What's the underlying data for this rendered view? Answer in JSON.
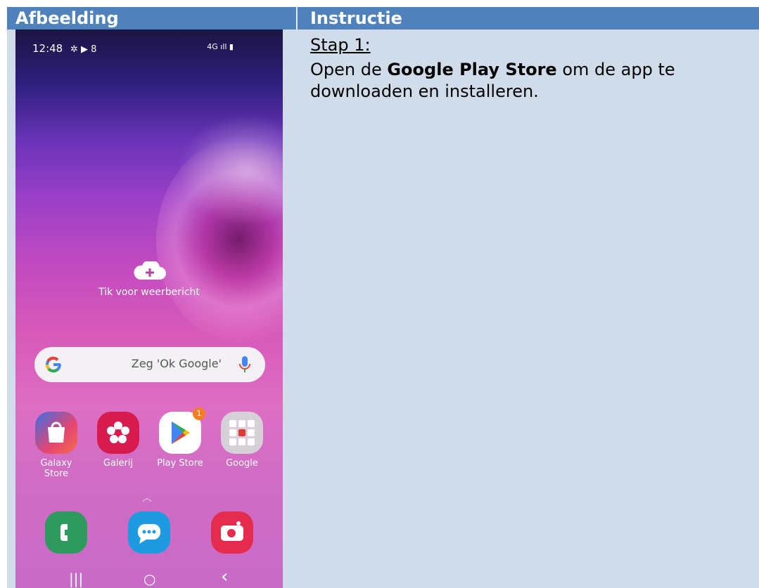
{
  "header": {
    "col1": "Afbeelding",
    "col2": "Instructie"
  },
  "phone": {
    "status_time": "12:48",
    "status_icons_left": "✲ ▶ 8",
    "status_icons_right": "4G ıll ▮",
    "weather_label": "Tik voor weerbericht",
    "search_hint": "Zeg 'Ok Google'",
    "apps": [
      {
        "label": "Galaxy Store",
        "icon": "galaxy-store-icon",
        "color": "#e64a7a"
      },
      {
        "label": "Galerij",
        "icon": "gallery-icon",
        "color": "#d81b4f"
      },
      {
        "label": "Play Store",
        "icon": "play-store-icon",
        "color": "#ffffff",
        "badge": "1"
      },
      {
        "label": "Google",
        "icon": "google-folder-icon",
        "color": "#d8d0d8"
      }
    ],
    "dock": [
      {
        "icon": "phone-icon",
        "color": "#2f9a5e"
      },
      {
        "icon": "messages-icon",
        "color": "#1e9be0"
      },
      {
        "icon": "camera-icon",
        "color": "#e52c4f"
      }
    ],
    "nav": {
      "recent": "|||",
      "home": "○",
      "back": "‹"
    }
  },
  "instruction": {
    "step": "Stap 1:",
    "text_before": "Open de ",
    "text_bold": "Google Play Store",
    "text_after": " om de app te downloaden en installeren."
  }
}
